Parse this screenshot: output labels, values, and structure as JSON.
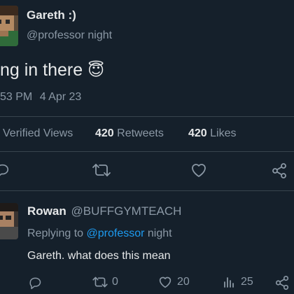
{
  "tweet": {
    "author_name": "Gareth :)",
    "author_handle": "@professor night",
    "text": "ng in there",
    "emoji": "😇",
    "time": "53 PM",
    "date": "4 Apr 23"
  },
  "stats": {
    "views_label": "Verified Views",
    "retweets_count": "420",
    "retweets_label": "Retweets",
    "likes_count": "420",
    "likes_label": "Likes"
  },
  "actions": {
    "icons": [
      "reply-icon",
      "retweet-icon",
      "like-icon",
      "share-icon"
    ]
  },
  "reply": {
    "author_name": "Rowan",
    "author_handle": "@BUFFGYMTEACH",
    "replying_prefix": "Replying to",
    "replying_mention": "@professor",
    "replying_suffix": "night",
    "text": "Gareth. what does this mean",
    "reply_count": "",
    "retweet_count": "0",
    "like_count": "20",
    "views_count": "25"
  },
  "colors": {
    "background": "#15202b",
    "text": "#e7e9ea",
    "muted": "#8b98a5",
    "accent": "#1d9bf0",
    "divider": "#38444d"
  }
}
